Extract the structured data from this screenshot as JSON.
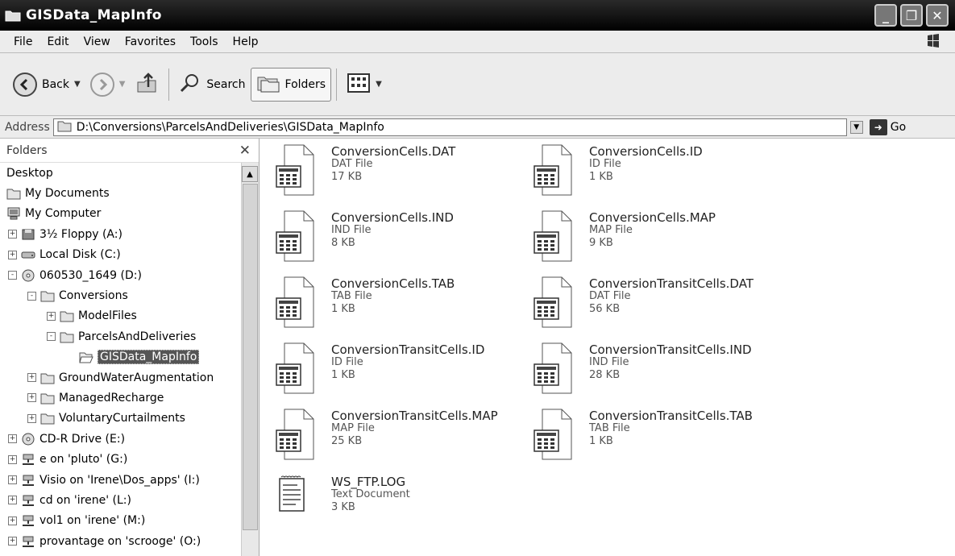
{
  "window": {
    "title": "GISData_MapInfo"
  },
  "menu": [
    "File",
    "Edit",
    "View",
    "Favorites",
    "Tools",
    "Help"
  ],
  "toolbar": {
    "back_label": "Back",
    "search_label": "Search",
    "folders_label": "Folders"
  },
  "address": {
    "label": "Address",
    "path": "D:\\Conversions\\ParcelsAndDeliveries\\GISData_MapInfo",
    "go_label": "Go"
  },
  "folders_pane": {
    "title": "Folders",
    "tree": [
      {
        "label": "Desktop",
        "level": 0,
        "exp": "",
        "icon": "none"
      },
      {
        "label": "My Documents",
        "level": 0,
        "exp": "",
        "icon": "folder"
      },
      {
        "label": "My Computer",
        "level": 0,
        "exp": "",
        "icon": "computer"
      },
      {
        "label": "3½ Floppy (A:)",
        "level": 1,
        "exp": "+",
        "icon": "floppy"
      },
      {
        "label": "Local Disk (C:)",
        "level": 1,
        "exp": "+",
        "icon": "disk"
      },
      {
        "label": "060530_1649 (D:)",
        "level": 1,
        "exp": "-",
        "icon": "cd"
      },
      {
        "label": "Conversions",
        "level": 2,
        "exp": "-",
        "icon": "folder"
      },
      {
        "label": "ModelFiles",
        "level": 3,
        "exp": "+",
        "icon": "folder"
      },
      {
        "label": "ParcelsAndDeliveries",
        "level": 3,
        "exp": "-",
        "icon": "folder"
      },
      {
        "label": "GISData_MapInfo",
        "level": 4,
        "exp": "",
        "icon": "folder-open",
        "selected": true
      },
      {
        "label": "GroundWaterAugmentation",
        "level": 2,
        "exp": "+",
        "icon": "folder"
      },
      {
        "label": "ManagedRecharge",
        "level": 2,
        "exp": "+",
        "icon": "folder"
      },
      {
        "label": "VoluntaryCurtailments",
        "level": 2,
        "exp": "+",
        "icon": "folder"
      },
      {
        "label": "CD-R Drive (E:)",
        "level": 1,
        "exp": "+",
        "icon": "cd"
      },
      {
        "label": "e on 'pluto' (G:)",
        "level": 1,
        "exp": "+",
        "icon": "network"
      },
      {
        "label": "Visio on 'Irene\\Dos_apps' (I:)",
        "level": 1,
        "exp": "+",
        "icon": "network"
      },
      {
        "label": "cd on 'irene' (L:)",
        "level": 1,
        "exp": "+",
        "icon": "network"
      },
      {
        "label": "vol1 on 'irene' (M:)",
        "level": 1,
        "exp": "+",
        "icon": "network"
      },
      {
        "label": "provantage on 'scrooge' (O:)",
        "level": 1,
        "exp": "+",
        "icon": "network"
      }
    ]
  },
  "files": [
    {
      "name": "ConversionCells.DAT",
      "type": "DAT File",
      "size": "17 KB",
      "icon": "grid-file-icon"
    },
    {
      "name": "ConversionCells.ID",
      "type": "ID File",
      "size": "1 KB",
      "icon": "grid-file-icon"
    },
    {
      "name": "ConversionCells.IND",
      "type": "IND File",
      "size": "8 KB",
      "icon": "grid-file-icon"
    },
    {
      "name": "ConversionCells.MAP",
      "type": "MAP File",
      "size": "9 KB",
      "icon": "grid-file-icon"
    },
    {
      "name": "ConversionCells.TAB",
      "type": "TAB File",
      "size": "1 KB",
      "icon": "grid-file-icon"
    },
    {
      "name": "ConversionTransitCells.DAT",
      "type": "DAT File",
      "size": "56 KB",
      "icon": "grid-file-icon"
    },
    {
      "name": "ConversionTransitCells.ID",
      "type": "ID File",
      "size": "1 KB",
      "icon": "grid-file-icon"
    },
    {
      "name": "ConversionTransitCells.IND",
      "type": "IND File",
      "size": "28 KB",
      "icon": "grid-file-icon"
    },
    {
      "name": "ConversionTransitCells.MAP",
      "type": "MAP File",
      "size": "25 KB",
      "icon": "grid-file-icon"
    },
    {
      "name": "ConversionTransitCells.TAB",
      "type": "TAB File",
      "size": "1 KB",
      "icon": "grid-file-icon"
    },
    {
      "name": "WS_FTP.LOG",
      "type": "Text Document",
      "size": "3 KB",
      "icon": "notepad-file-icon"
    }
  ]
}
